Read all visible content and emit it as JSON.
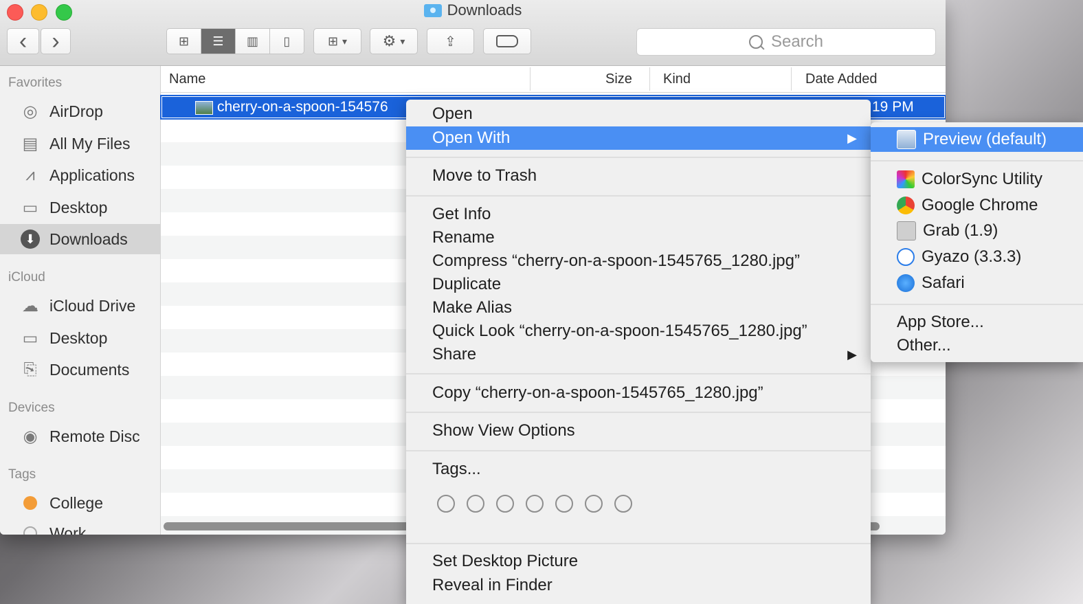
{
  "window": {
    "title": "Downloads",
    "toolbar": {
      "back_glyph": "‹",
      "forward_glyph": "›",
      "view_modes": [
        "icon-view",
        "list-view",
        "column-view",
        "coverflow-view"
      ],
      "active_view": "list-view",
      "search_placeholder": "Search"
    }
  },
  "sidebar": {
    "favorites_header": "Favorites",
    "favorites": [
      {
        "label": "AirDrop",
        "icon": "airdrop-icon"
      },
      {
        "label": "All My Files",
        "icon": "all-files-icon"
      },
      {
        "label": "Applications",
        "icon": "applications-icon"
      },
      {
        "label": "Desktop",
        "icon": "desktop-icon"
      },
      {
        "label": "Downloads",
        "icon": "downloads-icon",
        "selected": true
      }
    ],
    "icloud_header": "iCloud",
    "icloud": [
      {
        "label": "iCloud Drive",
        "icon": "cloud-icon"
      },
      {
        "label": "Desktop",
        "icon": "desktop-icon"
      },
      {
        "label": "Documents",
        "icon": "documents-icon"
      }
    ],
    "devices_header": "Devices",
    "devices": [
      {
        "label": "Remote Disc",
        "icon": "disc-icon"
      }
    ],
    "tags_header": "Tags",
    "tags": [
      {
        "label": "College",
        "color": "#f39c37"
      },
      {
        "label": "Work",
        "color": "#cccccc"
      }
    ]
  },
  "file_list": {
    "columns": {
      "name": "Name",
      "size": "Size",
      "kind": "Kind",
      "date_added": "Date Added"
    },
    "selected_file": {
      "name": "cherry-on-a-spoon-154576",
      "date_added": "19 PM"
    }
  },
  "context_menu": {
    "open": "Open",
    "open_with": "Open With",
    "move_to_trash": "Move to Trash",
    "get_info": "Get Info",
    "rename": "Rename",
    "compress": "Compress “cherry-on-a-spoon-1545765_1280.jpg”",
    "duplicate": "Duplicate",
    "make_alias": "Make Alias",
    "quick_look": "Quick Look “cherry-on-a-spoon-1545765_1280.jpg”",
    "share": "Share",
    "copy": "Copy “cherry-on-a-spoon-1545765_1280.jpg”",
    "show_view_options": "Show View Options",
    "tags": "Tags...",
    "set_desktop_picture": "Set Desktop Picture",
    "reveal_in_finder": "Reveal in Finder",
    "submenu_arrow": "▶"
  },
  "open_with_submenu": {
    "default": "Preview (default)",
    "apps": [
      {
        "label": "ColorSync Utility",
        "icon": "colorsync-icon"
      },
      {
        "label": "Google Chrome",
        "icon": "chrome-icon"
      },
      {
        "label": "Grab (1.9)",
        "icon": "grab-icon"
      },
      {
        "label": "Gyazo (3.3.3)",
        "icon": "gyazo-icon"
      },
      {
        "label": "Safari",
        "icon": "safari-icon"
      }
    ],
    "app_store": "App Store...",
    "other": "Other..."
  }
}
